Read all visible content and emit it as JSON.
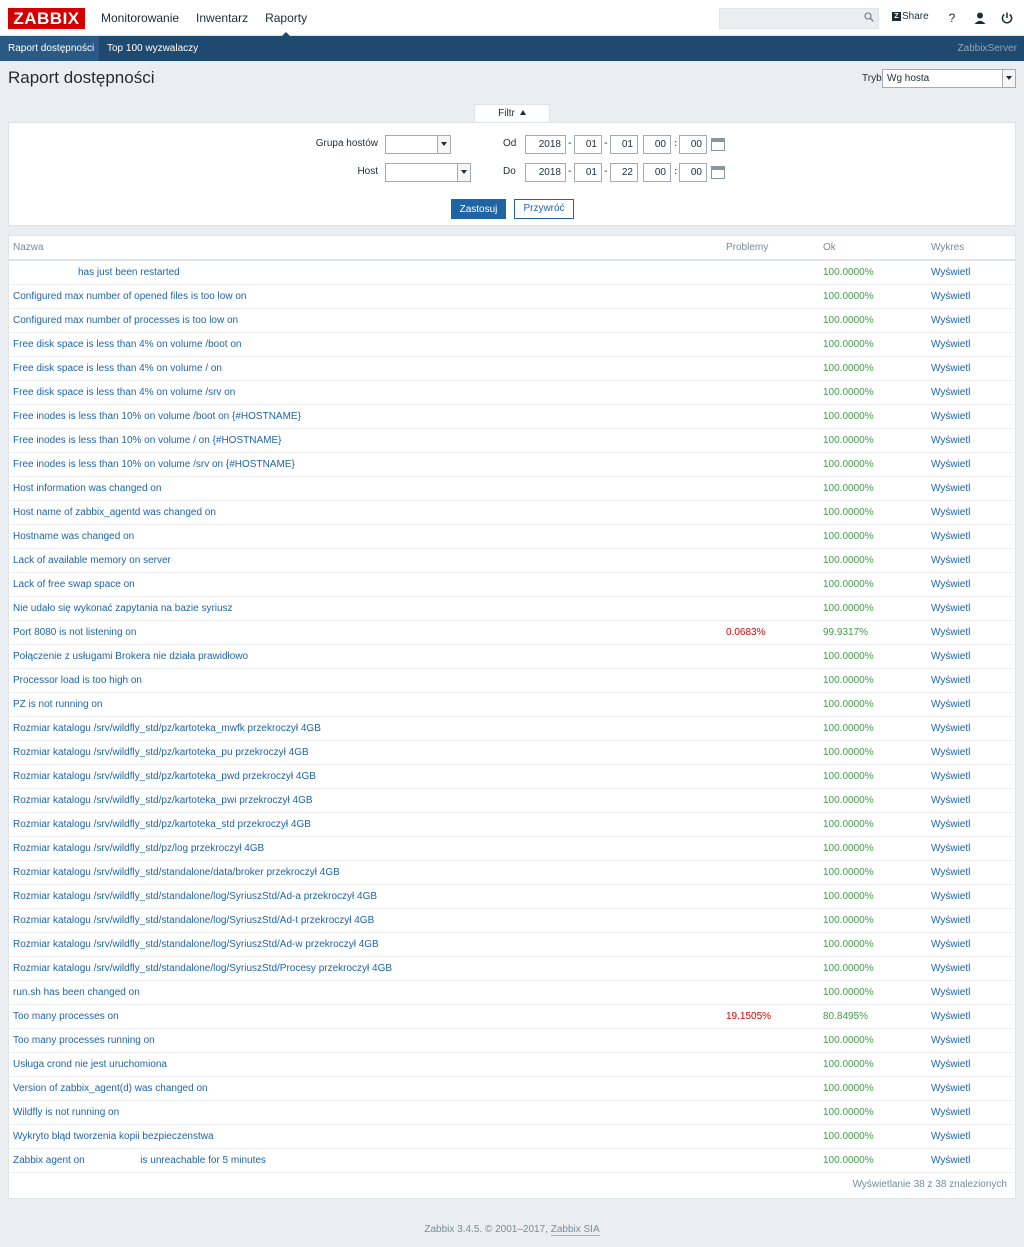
{
  "brand": {
    "logo": "ZABBIX",
    "color": "#d40000"
  },
  "topnav": [
    {
      "label": "Monitorowanie"
    },
    {
      "label": "Inwentarz"
    },
    {
      "label": "Raporty"
    }
  ],
  "top_actions": {
    "share": "Share",
    "help": "?",
    "icons": [
      "search-icon",
      "share-icon",
      "help-icon",
      "user-icon",
      "power-icon"
    ]
  },
  "subnav": {
    "items": [
      {
        "label": "Raport dostępności"
      },
      {
        "label": "Top 100 wyzwalaczy"
      }
    ],
    "server": "ZabbixServer"
  },
  "page": {
    "title": "Raport dostępności",
    "mode_label": "Tryb",
    "mode_value": "Wg hosta"
  },
  "filter": {
    "tab_label": "Filtr",
    "group_label": "Grupa hostów",
    "host_label": "Host",
    "from_label": "Od",
    "to_label": "Do",
    "from": {
      "year": "2018",
      "month": "01",
      "day": "01",
      "hour": "00",
      "minute": "00"
    },
    "to": {
      "year": "2018",
      "month": "01",
      "day": "22",
      "hour": "00",
      "minute": "00"
    },
    "apply": "Zastosuj",
    "reset": "Przywróć"
  },
  "table": {
    "headers": {
      "name": "Nazwa",
      "problems": "Problemy",
      "ok": "Ok",
      "graph": "Wykres"
    },
    "rows": [
      {
        "name": "has just been restarted",
        "problems": "",
        "ok": "100.0000%",
        "graph": "Wyświetl"
      },
      {
        "name": "Configured max number of opened files is too low on",
        "problems": "",
        "ok": "100.0000%",
        "graph": "Wyświetl"
      },
      {
        "name": "Configured max number of processes is too low on",
        "problems": "",
        "ok": "100.0000%",
        "graph": "Wyświetl"
      },
      {
        "name": "Free disk space is less than 4% on volume /boot on",
        "problems": "",
        "ok": "100.0000%",
        "graph": "Wyświetl"
      },
      {
        "name": "Free disk space is less than 4% on volume / on",
        "problems": "",
        "ok": "100.0000%",
        "graph": "Wyświetl"
      },
      {
        "name": "Free disk space is less than 4% on volume /srv on",
        "problems": "",
        "ok": "100.0000%",
        "graph": "Wyświetl"
      },
      {
        "name": "Free inodes is less than 10% on volume /boot on {#HOSTNAME}",
        "problems": "",
        "ok": "100.0000%",
        "graph": "Wyświetl"
      },
      {
        "name": "Free inodes is less than 10% on volume / on {#HOSTNAME}",
        "problems": "",
        "ok": "100.0000%",
        "graph": "Wyświetl"
      },
      {
        "name": "Free inodes is less than 10% on volume /srv on {#HOSTNAME}",
        "problems": "",
        "ok": "100.0000%",
        "graph": "Wyświetl"
      },
      {
        "name": "Host information was changed on",
        "problems": "",
        "ok": "100.0000%",
        "graph": "Wyświetl"
      },
      {
        "name": "Host name of zabbix_agentd was changed on",
        "problems": "",
        "ok": "100.0000%",
        "graph": "Wyświetl"
      },
      {
        "name": "Hostname was changed on",
        "problems": "",
        "ok": "100.0000%",
        "graph": "Wyświetl"
      },
      {
        "name": "Lack of available memory on server",
        "problems": "",
        "ok": "100.0000%",
        "graph": "Wyświetl"
      },
      {
        "name": "Lack of free swap space on",
        "problems": "",
        "ok": "100.0000%",
        "graph": "Wyświetl"
      },
      {
        "name": "Nie udało się wykonać zapytania na bazie syriusz",
        "problems": "",
        "ok": "100.0000%",
        "graph": "Wyświetl"
      },
      {
        "name": "Port 8080 is not listening on",
        "problems": "0.0683%",
        "ok": "99.9317%",
        "graph": "Wyświetl"
      },
      {
        "name": "Połączenie z usługami Brokera nie działa prawidłowo",
        "problems": "",
        "ok": "100.0000%",
        "graph": "Wyświetl"
      },
      {
        "name": "Processor load is too high on",
        "problems": "",
        "ok": "100.0000%",
        "graph": "Wyświetl"
      },
      {
        "name": "PZ is not running on",
        "problems": "",
        "ok": "100.0000%",
        "graph": "Wyświetl"
      },
      {
        "name": "Rozmiar katalogu /srv/wildfly_std/pz/kartoteka_mwfk przekroczył 4GB",
        "problems": "",
        "ok": "100.0000%",
        "graph": "Wyświetl"
      },
      {
        "name": "Rozmiar katalogu /srv/wildfly_std/pz/kartoteka_pu przekroczył 4GB",
        "problems": "",
        "ok": "100.0000%",
        "graph": "Wyświetl"
      },
      {
        "name": "Rozmiar katalogu /srv/wildfly_std/pz/kartoteka_pwd przekroczył 4GB",
        "problems": "",
        "ok": "100.0000%",
        "graph": "Wyświetl"
      },
      {
        "name": "Rozmiar katalogu /srv/wildfly_std/pz/kartoteka_pwi przekroczył 4GB",
        "problems": "",
        "ok": "100.0000%",
        "graph": "Wyświetl"
      },
      {
        "name": "Rozmiar katalogu /srv/wildfly_std/pz/kartoteka_std przekroczył 4GB",
        "problems": "",
        "ok": "100.0000%",
        "graph": "Wyświetl"
      },
      {
        "name": "Rozmiar katalogu /srv/wildfly_std/pz/log przekroczył 4GB",
        "problems": "",
        "ok": "100.0000%",
        "graph": "Wyświetl"
      },
      {
        "name": "Rozmiar katalogu /srv/wildfly_std/standalone/data/broker przekroczył 4GB",
        "problems": "",
        "ok": "100.0000%",
        "graph": "Wyświetl"
      },
      {
        "name": "Rozmiar katalogu /srv/wildfly_std/standalone/log/SyriuszStd/Ad-a przekroczył 4GB",
        "problems": "",
        "ok": "100.0000%",
        "graph": "Wyświetl"
      },
      {
        "name": "Rozmiar katalogu /srv/wildfly_std/standalone/log/SyriuszStd/Ad-t przekroczył 4GB",
        "problems": "",
        "ok": "100.0000%",
        "graph": "Wyświetl"
      },
      {
        "name": "Rozmiar katalogu /srv/wildfly_std/standalone/log/SyriuszStd/Ad-w przekroczył 4GB",
        "problems": "",
        "ok": "100.0000%",
        "graph": "Wyświetl"
      },
      {
        "name": "Rozmiar katalogu /srv/wildfly_std/standalone/log/SyriuszStd/Procesy przekroczył 4GB",
        "problems": "",
        "ok": "100.0000%",
        "graph": "Wyświetl"
      },
      {
        "name": "run.sh has been changed on",
        "problems": "",
        "ok": "100.0000%",
        "graph": "Wyświetl"
      },
      {
        "name": "Too many processes on",
        "problems": "19.1505%",
        "ok": "80.8495%",
        "graph": "Wyświetl"
      },
      {
        "name": "Too many processes running on",
        "problems": "",
        "ok": "100.0000%",
        "graph": "Wyświetl"
      },
      {
        "name": "Usługa crond nie jest uruchomiona",
        "problems": "",
        "ok": "100.0000%",
        "graph": "Wyświetl"
      },
      {
        "name": "Version of zabbix_agent(d) was changed on",
        "problems": "",
        "ok": "100.0000%",
        "graph": "Wyświetl"
      },
      {
        "name": "Wildfly is not running on",
        "problems": "",
        "ok": "100.0000%",
        "graph": "Wyświetl"
      },
      {
        "name": "Wykryto błąd tworzenia kopii bezpieczenstwa",
        "problems": "",
        "ok": "100.0000%",
        "graph": "Wyświetl"
      },
      {
        "name": "Zabbix agent on                    is unreachable for 5 minutes",
        "problems": "",
        "ok": "100.0000%",
        "graph": "Wyświetl"
      }
    ],
    "summary": "Wyświetlanie 38 z 38 znalezionych"
  },
  "footer": {
    "text": "Zabbix 3.4.5. © 2001–2017, ",
    "link": "Zabbix SIA"
  },
  "colors": {
    "accent": "#1f65a6",
    "navbar": "#1f4a6f",
    "ok": "#429e47",
    "problem": "#dc0000"
  }
}
